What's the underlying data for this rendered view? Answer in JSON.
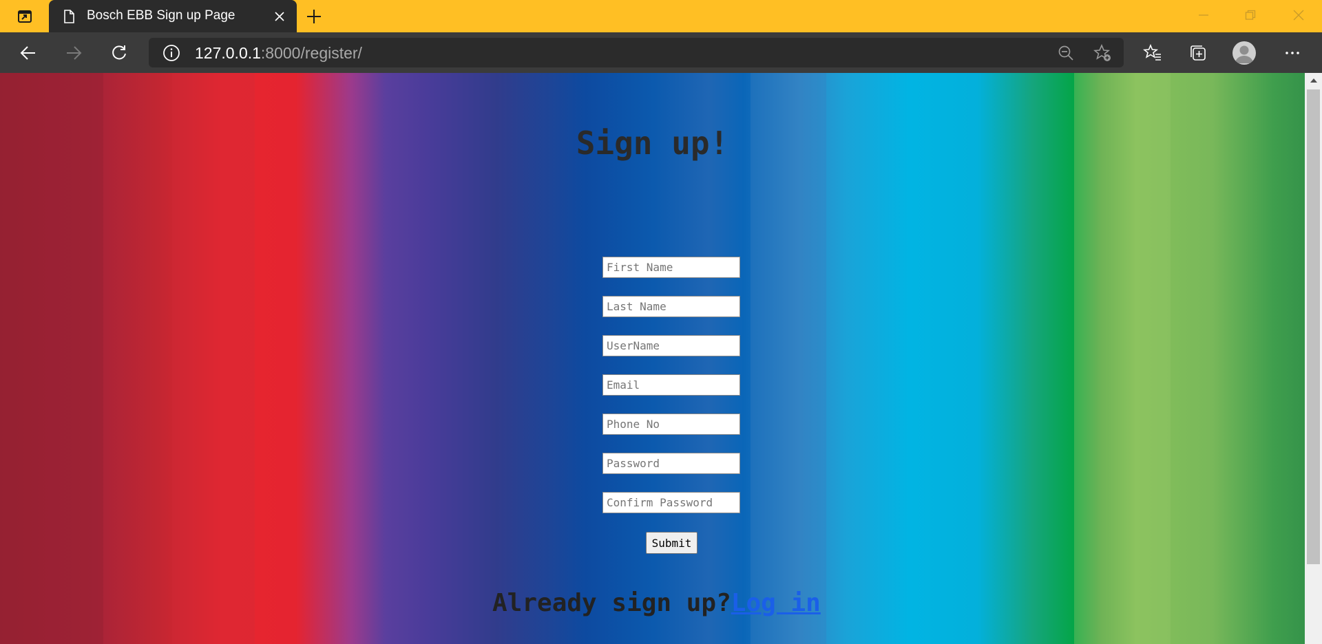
{
  "browser": {
    "tab_title": "Bosch EBB Sign up Page",
    "url_host": "127.0.0.1",
    "url_path": ":8000/register/",
    "accent_color": "#ffbf24"
  },
  "icons": {
    "app": "tab-actions-icon",
    "tab": "page-icon",
    "close": "close-icon",
    "new_tab": "plus-icon",
    "back": "back-arrow-icon",
    "forward": "forward-arrow-icon",
    "refresh": "refresh-icon",
    "info": "info-icon",
    "zoom": "zoom-out-icon",
    "add_favorite": "add-favorite-icon",
    "favorites": "favorites-icon",
    "collections": "collections-icon",
    "profile": "profile-icon",
    "menu": "more-icon"
  },
  "page": {
    "title": "Sign up!",
    "fields": {
      "first_name": "First Name",
      "last_name": "Last Name",
      "username": "UserName",
      "email": "Email",
      "phone": "Phone No",
      "password": "Password",
      "confirm_password": "Confirm Password"
    },
    "submit_label": "Submit",
    "already_text": "Already sign up?",
    "login_link": "Log in"
  }
}
